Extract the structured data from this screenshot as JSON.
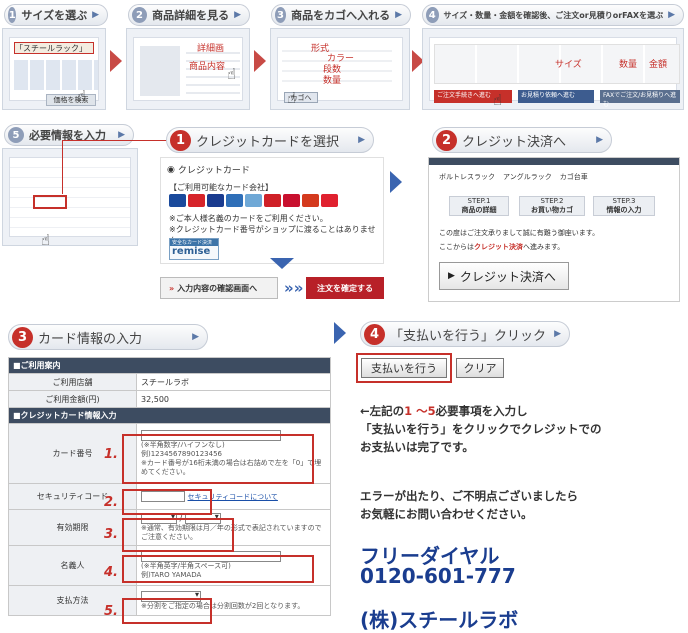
{
  "steps_top": [
    {
      "num": "1",
      "label": "サイズを選ぶ"
    },
    {
      "num": "2",
      "label": "商品詳細を見る"
    },
    {
      "num": "3",
      "label": "商品をカゴへ入れる"
    },
    {
      "num": "4",
      "label": "サイズ・数量・金額を確認後、ご注文or見積りorFAXを選ぶ"
    }
  ],
  "step5": {
    "num": "5",
    "label": "必要情報を入力"
  },
  "thumb1": {
    "tab": "「スチールラック」",
    "search_btn": "価格を検索"
  },
  "thumb2": {
    "labels": [
      "詳細画",
      "商品内容"
    ]
  },
  "thumb3": {
    "labels": [
      "形式",
      "カラー",
      "段数",
      "数量"
    ],
    "cart_btn": "カゴへ"
  },
  "thumb4": {
    "labels": [
      "サイズ",
      "数量",
      "金額"
    ],
    "buttons": [
      "ご注文手続きへ進む",
      "お見積り依頼へ進む",
      "FAXでご注文/お見積りへ進む"
    ]
  },
  "credit": {
    "step_num": "1",
    "step_label": "クレジットカードを選択",
    "radio_label": "クレジットカード",
    "usable_title": "【ご利用可能なカード会社】",
    "note1": "※ご本人様名義のカードをご利用ください。",
    "note2": "※クレジットカード番号がショップに渡ることはありません。",
    "remise_small": "安全なカード決済",
    "remise_logo": "remise",
    "confirm_btn": "入力内容の確認画面へ",
    "order_btn": "注文を確定する"
  },
  "card_colors": [
    "#1a4a9c",
    "#d6242a",
    "#1a3b8f",
    "#2f6fb8",
    "#6fa8d6",
    "#cf2027",
    "#c8102e",
    "#d43a1e",
    "#e0212f"
  ],
  "settle": {
    "step_num": "2",
    "step_label": "クレジット決済へ",
    "tabs": [
      "ボルトレスラック",
      "アングルラック",
      "カゴ台車"
    ],
    "steps": [
      {
        "no": "STEP.1",
        "label": "商品の詳細"
      },
      {
        "no": "STEP.2",
        "label": "お買い物カゴ"
      },
      {
        "no": "STEP.3",
        "label": "情報の入力"
      }
    ],
    "text1": "この度はご注文承りまして誠に有難う御座います。",
    "text2_pre": "ここからは",
    "text2_link": "クレジット決済",
    "text2_post": "へ進みます。",
    "button": "クレジット決済へ"
  },
  "cardinfo": {
    "step_num": "3",
    "step_label": "カード情報の入力",
    "sec1": "■ご利用案内",
    "store_label": "ご利用店舗",
    "store_value": "スチールラボ",
    "amount_label": "ご利用金額(円)",
    "amount_value": "32,500",
    "sec2": "■クレジットカード情報入力",
    "card_label": "カード番号",
    "card_note1": "(※半角数字/ハイフンなし)",
    "card_note2": "例)1234567890123456",
    "card_note3": "※カード番号が16桁未満の場合は右詰めで左を「0」で埋めてください。",
    "sec_label": "セキュリティコード",
    "sec_link": "セキュリティコードについて",
    "exp_label": "有効期限",
    "exp_note": "※通常、有効期限は月／年の形式で表記されていますのでご注意ください。",
    "name_label": "名義人",
    "name_note1": "(※半角英字/半角スペース可)",
    "name_note2": "例)TARO YAMADA",
    "pay_label": "支払方法",
    "pay_note": "※分割をご指定の場合は分割回数が2回となります。",
    "numbers": [
      "1.",
      "2.",
      "3.",
      "4.",
      "5."
    ]
  },
  "payment": {
    "step_num": "4",
    "step_label": "「支払いを行う」クリック",
    "pay_btn": "支払いを行う",
    "clear_btn": "クリア",
    "instr_pre": "←左記の",
    "instr_range": "1 〜5",
    "instr_post": "必要事項を入力し",
    "instr2": "「支払いを行う」をクリックでクレジットでの",
    "instr3": "お支払いは完了です。",
    "err1": "エラーが出たり、ご不明点ございましたら",
    "err2": "お気軽にお問い合わせください。",
    "dial_label": "フリーダイヤル",
    "dial_number": "0120-601-777",
    "company": "(株)スチールラボ"
  }
}
